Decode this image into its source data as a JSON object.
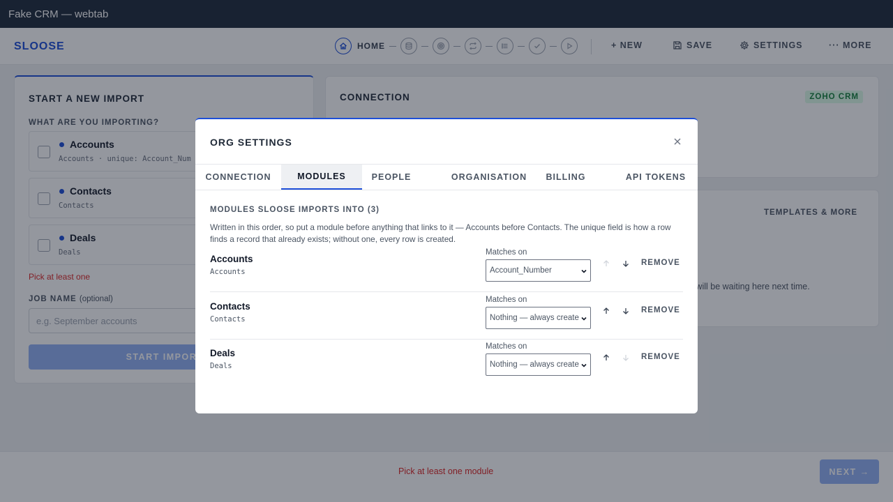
{
  "window": {
    "title": "Fake CRM — webtab"
  },
  "header": {
    "logo": "SLOOSE",
    "steps": {
      "home_label": "HOME"
    },
    "actions": {
      "new": "+ NEW",
      "save": "SAVE",
      "settings": "SETTINGS",
      "more": "··· MORE"
    }
  },
  "import_card": {
    "title": "START A NEW IMPORT",
    "question": "WHAT ARE YOU IMPORTING?",
    "options": [
      {
        "name": "Accounts",
        "meta": "Accounts · unique: Account_Num"
      },
      {
        "name": "Contacts",
        "meta": "Contacts"
      },
      {
        "name": "Deals",
        "meta": "Deals"
      }
    ],
    "error": "Pick at least one",
    "job_label": "JOB NAME",
    "job_optional": "(optional)",
    "job_placeholder": "e.g. September accounts",
    "start_label": "START IMPORT"
  },
  "connection_card": {
    "title": "CONNECTION",
    "badge": "ZOHO CRM"
  },
  "templates_card": {
    "link": "TEMPLATES & MORE",
    "text": "o will be waiting here next time."
  },
  "footer": {
    "message": "Pick at least one module",
    "next_label": "NEXT →"
  },
  "modal": {
    "title": "ORG SETTINGS",
    "tabs": [
      "CONNECTION",
      "MODULES",
      "PEOPLE",
      "ORGANISATION",
      "BILLING",
      "API TOKENS"
    ],
    "active_tab": "MODULES",
    "heading": "MODULES SLOOSE IMPORTS INTO (3)",
    "description": "Written in this order, so put a module before anything that links to it — Accounts before Contacts. The unique field is how a row finds a record that already exists; without one, every row is created.",
    "match_label": "Matches on",
    "remove_label": "REMOVE",
    "rows": [
      {
        "name": "Accounts",
        "sub": "Accounts",
        "match": "Account_Number",
        "up_enabled": false,
        "down_enabled": true
      },
      {
        "name": "Contacts",
        "sub": "Contacts",
        "match": "Nothing — always create",
        "up_enabled": true,
        "down_enabled": true
      },
      {
        "name": "Deals",
        "sub": "Deals",
        "match": "Nothing — always create",
        "up_enabled": true,
        "down_enabled": false
      }
    ]
  },
  "colors": {
    "accent": "#1d4ed8",
    "error": "#dc2626",
    "badge_bg": "#dcfce7",
    "badge_text": "#15803d",
    "disabled_button": "#93b1f5"
  }
}
